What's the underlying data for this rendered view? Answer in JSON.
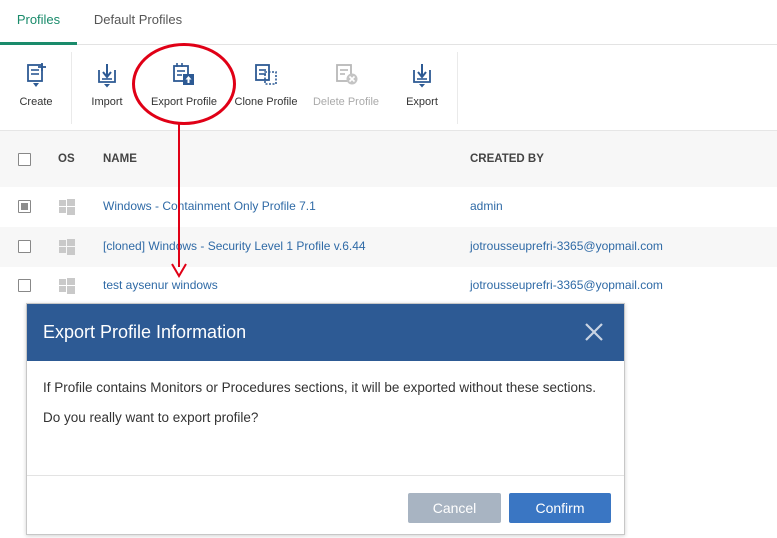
{
  "tabs": [
    {
      "label": "Profiles",
      "active": true
    },
    {
      "label": "Default Profiles",
      "active": false
    }
  ],
  "toolbar": {
    "create": {
      "label": "Create",
      "icon": "create-icon"
    },
    "import": {
      "label": "Import",
      "icon": "import-icon"
    },
    "export_profile": {
      "label": "Export Profile",
      "icon": "export-profile-icon"
    },
    "clone_profile": {
      "label": "Clone Profile",
      "icon": "clone-profile-icon"
    },
    "delete_profile": {
      "label": "Delete Profile",
      "icon": "delete-profile-icon",
      "disabled": true
    },
    "export": {
      "label": "Export",
      "icon": "export-icon"
    }
  },
  "table": {
    "columns": {
      "os": "OS",
      "name": "NAME",
      "created_by": "CREATED BY"
    },
    "rows": [
      {
        "name": "Windows - Containment Only Profile 7.1",
        "created_by": "admin",
        "checked": true
      },
      {
        "name": "[cloned] Windows - Security Level 1 Profile v.6.44",
        "created_by": "jotrousseuprefri-3365@yopmail.com",
        "checked": false
      },
      {
        "name": "test aysenur windows",
        "created_by": "jotrousseuprefri-3365@yopmail.com",
        "checked": false
      }
    ]
  },
  "dialog": {
    "title": "Export Profile Information",
    "message_1": "If Profile contains Monitors or Procedures sections, it will be exported without these sections.",
    "message_2": "Do you really want to export profile?",
    "cancel_label": "Cancel",
    "confirm_label": "Confirm"
  },
  "colors": {
    "accent_green": "#1a8b6b",
    "link_blue": "#2f6aa6",
    "dialog_header": "#2d5a94",
    "confirm_button": "#3a76c3",
    "cancel_button": "#a8b4c2",
    "callout_red": "#e00016"
  }
}
